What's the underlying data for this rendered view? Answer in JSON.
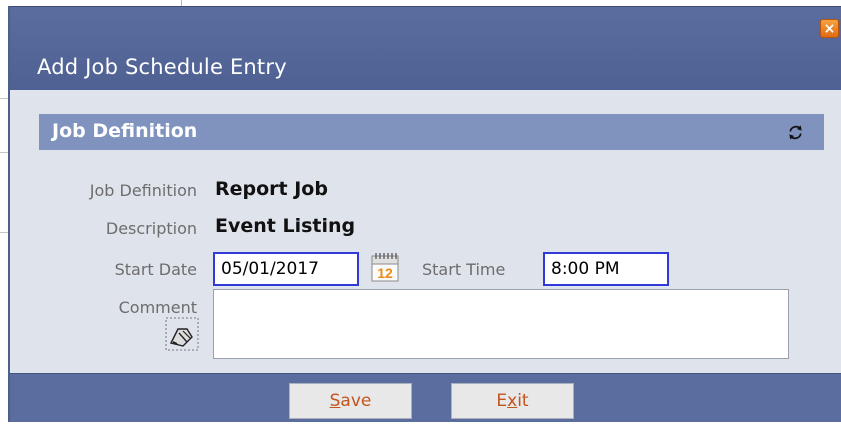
{
  "dialog": {
    "title": "Add Job Schedule Entry",
    "close_label": "×"
  },
  "section": {
    "title": "Job Definition",
    "refresh_icon": "refresh-icon"
  },
  "fields": {
    "job_definition_label": "Job Definition",
    "job_definition_value": "Report Job",
    "description_label": "Description",
    "description_value": "Event Listing",
    "start_date_label": "Start Date",
    "start_date_value": "05/01/2017",
    "start_time_label": "Start Time",
    "start_time_value": "8:00 PM",
    "comment_label": "Comment",
    "comment_value": "",
    "calendar_icon_text": "12"
  },
  "buttons": {
    "save_first": "S",
    "save_rest": "ave",
    "exit_first": "E",
    "exit_mid": "x",
    "exit_rest": "it"
  },
  "colors": {
    "title_bar": "#5a6d9e",
    "section_header": "#8093bf",
    "dialog_bg": "#dfe3ec",
    "close_button": "#e06b12",
    "input_border": "#2f3ad8",
    "button_text": "#c4531e"
  }
}
